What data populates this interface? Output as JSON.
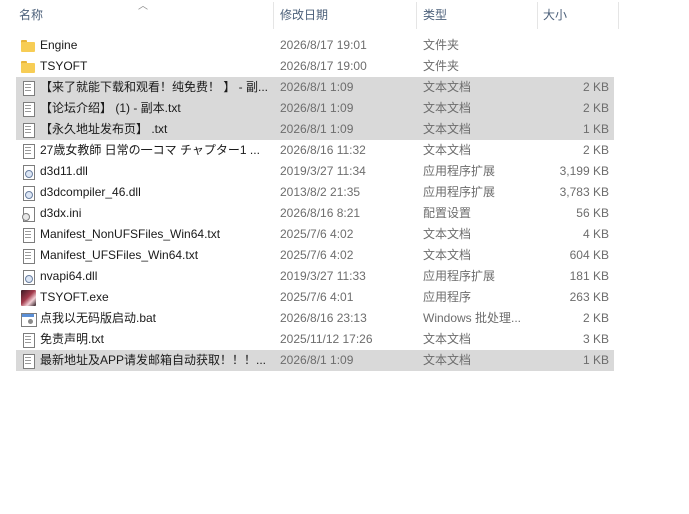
{
  "columns": {
    "name": "名称",
    "date": "修改日期",
    "type": "类型",
    "size": "大小"
  },
  "files": [
    {
      "name": "Engine",
      "date": "2026/8/17 19:01",
      "type": "文件夹",
      "size": "",
      "icon": "folder-icon",
      "selected": false
    },
    {
      "name": "TSYOFT",
      "date": "2026/8/17 19:00",
      "type": "文件夹",
      "size": "",
      "icon": "folder-icon",
      "selected": false
    },
    {
      "name": "【来了就能下载和观看！纯免费！ 】 - 副...",
      "date": "2026/8/1 1:09",
      "type": "文本文档",
      "size": "2 KB",
      "icon": "text-file-icon",
      "selected": true
    },
    {
      "name": "【论坛介绍】 (1) - 副本.txt",
      "date": "2026/8/1 1:09",
      "type": "文本文档",
      "size": "2 KB",
      "icon": "text-file-icon",
      "selected": true
    },
    {
      "name": "【永久地址发布页】 .txt",
      "date": "2026/8/1 1:09",
      "type": "文本文档",
      "size": "1 KB",
      "icon": "text-file-icon",
      "selected": true
    },
    {
      "name": "27歳女教師 日常の一コマ チャプター1 ...",
      "date": "2026/8/16 11:32",
      "type": "文本文档",
      "size": "2 KB",
      "icon": "text-file-icon",
      "selected": false
    },
    {
      "name": "d3d11.dll",
      "date": "2019/3/27 11:34",
      "type": "应用程序扩展",
      "size": "3,199 KB",
      "icon": "dll-file-icon",
      "selected": false
    },
    {
      "name": "d3dcompiler_46.dll",
      "date": "2013/8/2 21:35",
      "type": "应用程序扩展",
      "size": "3,783 KB",
      "icon": "dll-file-icon",
      "selected": false
    },
    {
      "name": "d3dx.ini",
      "date": "2026/8/16 8:21",
      "type": "配置设置",
      "size": "56 KB",
      "icon": "ini-file-icon",
      "selected": false
    },
    {
      "name": "Manifest_NonUFSFiles_Win64.txt",
      "date": "2025/7/6 4:02",
      "type": "文本文档",
      "size": "4 KB",
      "icon": "text-file-icon",
      "selected": false
    },
    {
      "name": "Manifest_UFSFiles_Win64.txt",
      "date": "2025/7/6 4:02",
      "type": "文本文档",
      "size": "604 KB",
      "icon": "text-file-icon",
      "selected": false
    },
    {
      "name": "nvapi64.dll",
      "date": "2019/3/27 11:33",
      "type": "应用程序扩展",
      "size": "181 KB",
      "icon": "dll-file-icon",
      "selected": false
    },
    {
      "name": "TSYOFT.exe",
      "date": "2025/7/6 4:01",
      "type": "应用程序",
      "size": "263 KB",
      "icon": "exe-file-icon",
      "selected": false
    },
    {
      "name": "点我以无码版启动.bat",
      "date": "2026/8/16 23:13",
      "type": "Windows 批处理...",
      "size": "2 KB",
      "icon": "batch-file-icon",
      "selected": false
    },
    {
      "name": "免责声明.txt",
      "date": "2025/11/12 17:26",
      "type": "文本文档",
      "size": "3 KB",
      "icon": "text-file-icon",
      "selected": false
    },
    {
      "name": "最新地址及APP请发邮箱自动获取！！！...",
      "date": "2026/8/1 1:09",
      "type": "文本文档",
      "size": "1 KB",
      "icon": "text-file-icon",
      "selected": true
    }
  ]
}
